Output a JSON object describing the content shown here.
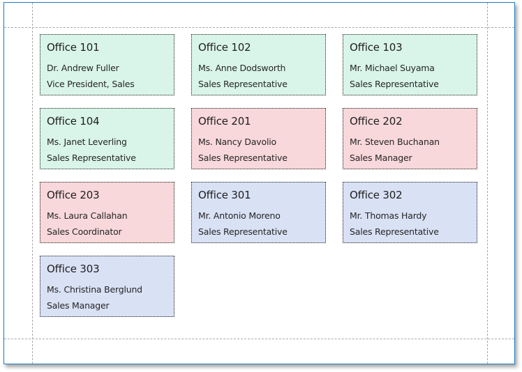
{
  "colors": {
    "floor1": "#d9f5e9",
    "floor2": "#f8d8da",
    "floor3": "#d9e1f5"
  },
  "cards": [
    {
      "office": "Office 101",
      "name": "Dr. Andrew Fuller",
      "title": "Vice President, Sales",
      "floor": "floor1"
    },
    {
      "office": "Office 102",
      "name": "Ms. Anne Dodsworth",
      "title": "Sales Representative",
      "floor": "floor1"
    },
    {
      "office": "Office 103",
      "name": "Mr. Michael Suyama",
      "title": "Sales Representative",
      "floor": "floor1"
    },
    {
      "office": "Office 104",
      "name": "Ms. Janet Leverling",
      "title": "Sales Representative",
      "floor": "floor1"
    },
    {
      "office": "Office 201",
      "name": "Ms. Nancy Davolio",
      "title": "Sales Representative",
      "floor": "floor2"
    },
    {
      "office": "Office 202",
      "name": "Mr. Steven Buchanan",
      "title": "Sales Manager",
      "floor": "floor2"
    },
    {
      "office": "Office 203",
      "name": "Ms. Laura Callahan",
      "title": "Sales Coordinator",
      "floor": "floor2"
    },
    {
      "office": "Office 301",
      "name": "Mr. Antonio Moreno",
      "title": "Sales Representative",
      "floor": "floor3"
    },
    {
      "office": "Office 302",
      "name": "Mr. Thomas Hardy",
      "title": "Sales Representative",
      "floor": "floor3"
    },
    {
      "office": "Office 303",
      "name": "Ms. Christina Berglund",
      "title": "Sales Manager",
      "floor": "floor3"
    }
  ]
}
